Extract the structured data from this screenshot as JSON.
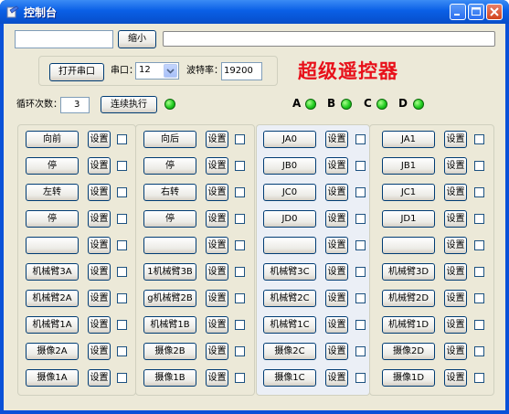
{
  "window": {
    "title": "控制台"
  },
  "top": {
    "shrink_label": "缩小",
    "open_port_label": "打开串口",
    "port_label": "串口：",
    "port_value": "12",
    "baud_label": "波特率：",
    "baud_value": "19200",
    "title_big": "超级遥控器",
    "loop_label": "循环次数：",
    "loop_value": "3",
    "run_label": "连续执行"
  },
  "leds": [
    {
      "label": "A"
    },
    {
      "label": "B"
    },
    {
      "label": "C"
    },
    {
      "label": "D"
    }
  ],
  "set_label": "设置",
  "columns": [
    {
      "buttons": [
        "向前",
        "停",
        "左转",
        "停",
        "",
        "机械臂3A",
        "机械臂2A",
        "机械臂1A",
        "摄像2A",
        "摄像1A"
      ]
    },
    {
      "buttons": [
        "向后",
        "停",
        "右转",
        "停",
        "",
        "1机械臂3B",
        "g机械臂2B",
        "机械臂1B",
        "摄像2B",
        "摄像1B"
      ]
    },
    {
      "buttons": [
        "JA0",
        "JB0",
        "JC0",
        "JD0",
        "",
        "机械臂3C",
        "机械臂2C",
        "机械臂1C",
        "摄像2C",
        "摄像1C"
      ]
    },
    {
      "buttons": [
        "JA1",
        "JB1",
        "JC1",
        "JD1",
        "",
        "机械臂3D",
        "机械臂2D",
        "机械臂1D",
        "摄像2D",
        "摄像1D"
      ]
    }
  ]
}
